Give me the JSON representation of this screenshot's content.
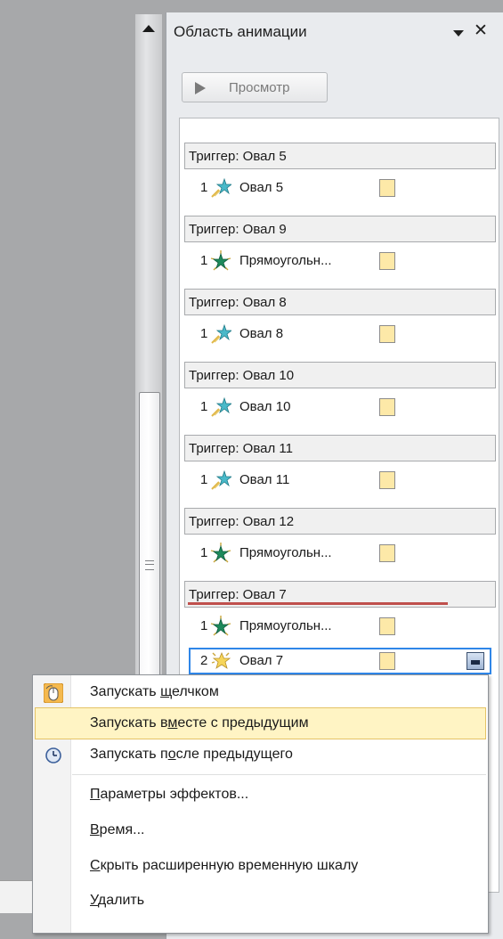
{
  "pane": {
    "title": "Область анимации",
    "play_label": "Просмотр"
  },
  "groups": [
    {
      "trigger": "Триггер: Овал 5",
      "effects": [
        {
          "num": "1",
          "name": "Овал 5",
          "icon": "fly-in-star-icon"
        }
      ]
    },
    {
      "trigger": "Триггер: Овал 9",
      "effects": [
        {
          "num": "1",
          "name": "Прямоугольн...",
          "icon": "green-burst-star-icon"
        }
      ]
    },
    {
      "trigger": "Триггер: Овал 8",
      "effects": [
        {
          "num": "1",
          "name": "Овал 8",
          "icon": "fly-in-star-icon"
        }
      ]
    },
    {
      "trigger": "Триггер: Овал 10",
      "effects": [
        {
          "num": "1",
          "name": "Овал 10",
          "icon": "fly-in-star-icon"
        }
      ]
    },
    {
      "trigger": "Триггер: Овал 11",
      "effects": [
        {
          "num": "1",
          "name": "Овал 11",
          "icon": "fly-in-star-icon"
        }
      ]
    },
    {
      "trigger": "Триггер: Овал 12",
      "effects": [
        {
          "num": "1",
          "name": "Прямоугольн...",
          "icon": "green-burst-star-icon"
        }
      ]
    },
    {
      "trigger": "Триггер: Овал 7",
      "effects": [
        {
          "num": "1",
          "name": "Прямоугольн...",
          "icon": "green-burst-star-icon"
        },
        {
          "num": "2",
          "name": "Овал 7",
          "icon": "yellow-emphasis-star-icon"
        }
      ]
    }
  ],
  "menu": {
    "items": [
      {
        "pre": "Запускать ",
        "key": "щ",
        "post": "елчком",
        "icon": "mouse-click-icon"
      },
      {
        "pre": "Запускать в",
        "key": "м",
        "post": "есте с предыдущим",
        "icon": ""
      },
      {
        "pre": "Запускать п",
        "key": "о",
        "post": "сле предыдущего",
        "icon": "clock-icon"
      },
      {
        "pre": "",
        "key": "П",
        "post": "араметры эффектов...",
        "icon": ""
      },
      {
        "pre": "",
        "key": "В",
        "post": "ремя...",
        "icon": ""
      },
      {
        "pre": "",
        "key": "С",
        "post": "крыть расширенную временную шкалу",
        "icon": ""
      },
      {
        "pre": "",
        "key": "У",
        "post": "далить",
        "icon": ""
      }
    ]
  },
  "colors": {
    "selection_border": "#2f86e8",
    "menu_highlight": "#fff4c4",
    "drop_indicator": "#c0504d",
    "timing_bar": "#fde9a8"
  }
}
